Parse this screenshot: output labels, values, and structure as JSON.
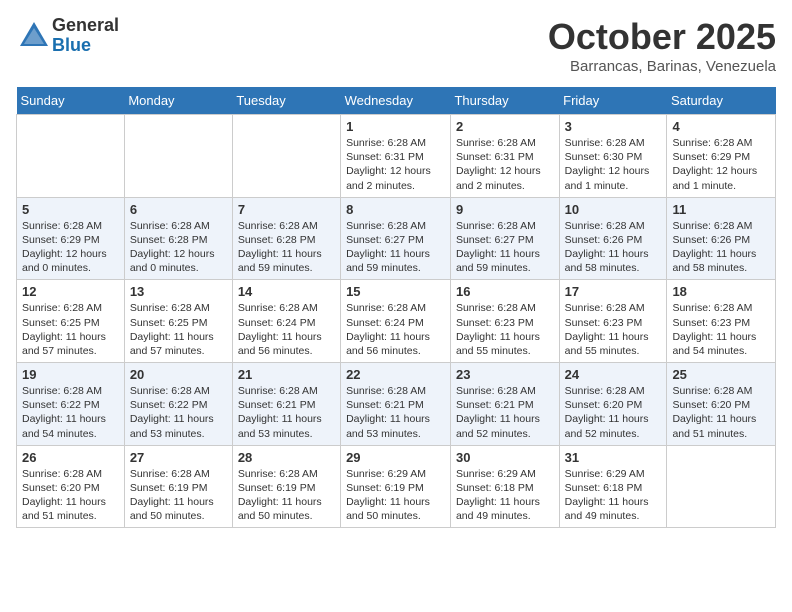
{
  "header": {
    "logo_general": "General",
    "logo_blue": "Blue",
    "month_title": "October 2025",
    "location": "Barrancas, Barinas, Venezuela"
  },
  "days_of_week": [
    "Sunday",
    "Monday",
    "Tuesday",
    "Wednesday",
    "Thursday",
    "Friday",
    "Saturday"
  ],
  "weeks": [
    [
      {
        "day": "",
        "sunrise": "",
        "sunset": "",
        "daylight": ""
      },
      {
        "day": "",
        "sunrise": "",
        "sunset": "",
        "daylight": ""
      },
      {
        "day": "",
        "sunrise": "",
        "sunset": "",
        "daylight": ""
      },
      {
        "day": "1",
        "sunrise": "Sunrise: 6:28 AM",
        "sunset": "Sunset: 6:31 PM",
        "daylight": "Daylight: 12 hours and 2 minutes."
      },
      {
        "day": "2",
        "sunrise": "Sunrise: 6:28 AM",
        "sunset": "Sunset: 6:31 PM",
        "daylight": "Daylight: 12 hours and 2 minutes."
      },
      {
        "day": "3",
        "sunrise": "Sunrise: 6:28 AM",
        "sunset": "Sunset: 6:30 PM",
        "daylight": "Daylight: 12 hours and 1 minute."
      },
      {
        "day": "4",
        "sunrise": "Sunrise: 6:28 AM",
        "sunset": "Sunset: 6:29 PM",
        "daylight": "Daylight: 12 hours and 1 minute."
      }
    ],
    [
      {
        "day": "5",
        "sunrise": "Sunrise: 6:28 AM",
        "sunset": "Sunset: 6:29 PM",
        "daylight": "Daylight: 12 hours and 0 minutes."
      },
      {
        "day": "6",
        "sunrise": "Sunrise: 6:28 AM",
        "sunset": "Sunset: 6:28 PM",
        "daylight": "Daylight: 12 hours and 0 minutes."
      },
      {
        "day": "7",
        "sunrise": "Sunrise: 6:28 AM",
        "sunset": "Sunset: 6:28 PM",
        "daylight": "Daylight: 11 hours and 59 minutes."
      },
      {
        "day": "8",
        "sunrise": "Sunrise: 6:28 AM",
        "sunset": "Sunset: 6:27 PM",
        "daylight": "Daylight: 11 hours and 59 minutes."
      },
      {
        "day": "9",
        "sunrise": "Sunrise: 6:28 AM",
        "sunset": "Sunset: 6:27 PM",
        "daylight": "Daylight: 11 hours and 59 minutes."
      },
      {
        "day": "10",
        "sunrise": "Sunrise: 6:28 AM",
        "sunset": "Sunset: 6:26 PM",
        "daylight": "Daylight: 11 hours and 58 minutes."
      },
      {
        "day": "11",
        "sunrise": "Sunrise: 6:28 AM",
        "sunset": "Sunset: 6:26 PM",
        "daylight": "Daylight: 11 hours and 58 minutes."
      }
    ],
    [
      {
        "day": "12",
        "sunrise": "Sunrise: 6:28 AM",
        "sunset": "Sunset: 6:25 PM",
        "daylight": "Daylight: 11 hours and 57 minutes."
      },
      {
        "day": "13",
        "sunrise": "Sunrise: 6:28 AM",
        "sunset": "Sunset: 6:25 PM",
        "daylight": "Daylight: 11 hours and 57 minutes."
      },
      {
        "day": "14",
        "sunrise": "Sunrise: 6:28 AM",
        "sunset": "Sunset: 6:24 PM",
        "daylight": "Daylight: 11 hours and 56 minutes."
      },
      {
        "day": "15",
        "sunrise": "Sunrise: 6:28 AM",
        "sunset": "Sunset: 6:24 PM",
        "daylight": "Daylight: 11 hours and 56 minutes."
      },
      {
        "day": "16",
        "sunrise": "Sunrise: 6:28 AM",
        "sunset": "Sunset: 6:23 PM",
        "daylight": "Daylight: 11 hours and 55 minutes."
      },
      {
        "day": "17",
        "sunrise": "Sunrise: 6:28 AM",
        "sunset": "Sunset: 6:23 PM",
        "daylight": "Daylight: 11 hours and 55 minutes."
      },
      {
        "day": "18",
        "sunrise": "Sunrise: 6:28 AM",
        "sunset": "Sunset: 6:23 PM",
        "daylight": "Daylight: 11 hours and 54 minutes."
      }
    ],
    [
      {
        "day": "19",
        "sunrise": "Sunrise: 6:28 AM",
        "sunset": "Sunset: 6:22 PM",
        "daylight": "Daylight: 11 hours and 54 minutes."
      },
      {
        "day": "20",
        "sunrise": "Sunrise: 6:28 AM",
        "sunset": "Sunset: 6:22 PM",
        "daylight": "Daylight: 11 hours and 53 minutes."
      },
      {
        "day": "21",
        "sunrise": "Sunrise: 6:28 AM",
        "sunset": "Sunset: 6:21 PM",
        "daylight": "Daylight: 11 hours and 53 minutes."
      },
      {
        "day": "22",
        "sunrise": "Sunrise: 6:28 AM",
        "sunset": "Sunset: 6:21 PM",
        "daylight": "Daylight: 11 hours and 53 minutes."
      },
      {
        "day": "23",
        "sunrise": "Sunrise: 6:28 AM",
        "sunset": "Sunset: 6:21 PM",
        "daylight": "Daylight: 11 hours and 52 minutes."
      },
      {
        "day": "24",
        "sunrise": "Sunrise: 6:28 AM",
        "sunset": "Sunset: 6:20 PM",
        "daylight": "Daylight: 11 hours and 52 minutes."
      },
      {
        "day": "25",
        "sunrise": "Sunrise: 6:28 AM",
        "sunset": "Sunset: 6:20 PM",
        "daylight": "Daylight: 11 hours and 51 minutes."
      }
    ],
    [
      {
        "day": "26",
        "sunrise": "Sunrise: 6:28 AM",
        "sunset": "Sunset: 6:20 PM",
        "daylight": "Daylight: 11 hours and 51 minutes."
      },
      {
        "day": "27",
        "sunrise": "Sunrise: 6:28 AM",
        "sunset": "Sunset: 6:19 PM",
        "daylight": "Daylight: 11 hours and 50 minutes."
      },
      {
        "day": "28",
        "sunrise": "Sunrise: 6:28 AM",
        "sunset": "Sunset: 6:19 PM",
        "daylight": "Daylight: 11 hours and 50 minutes."
      },
      {
        "day": "29",
        "sunrise": "Sunrise: 6:29 AM",
        "sunset": "Sunset: 6:19 PM",
        "daylight": "Daylight: 11 hours and 50 minutes."
      },
      {
        "day": "30",
        "sunrise": "Sunrise: 6:29 AM",
        "sunset": "Sunset: 6:18 PM",
        "daylight": "Daylight: 11 hours and 49 minutes."
      },
      {
        "day": "31",
        "sunrise": "Sunrise: 6:29 AM",
        "sunset": "Sunset: 6:18 PM",
        "daylight": "Daylight: 11 hours and 49 minutes."
      },
      {
        "day": "",
        "sunrise": "",
        "sunset": "",
        "daylight": ""
      }
    ]
  ]
}
